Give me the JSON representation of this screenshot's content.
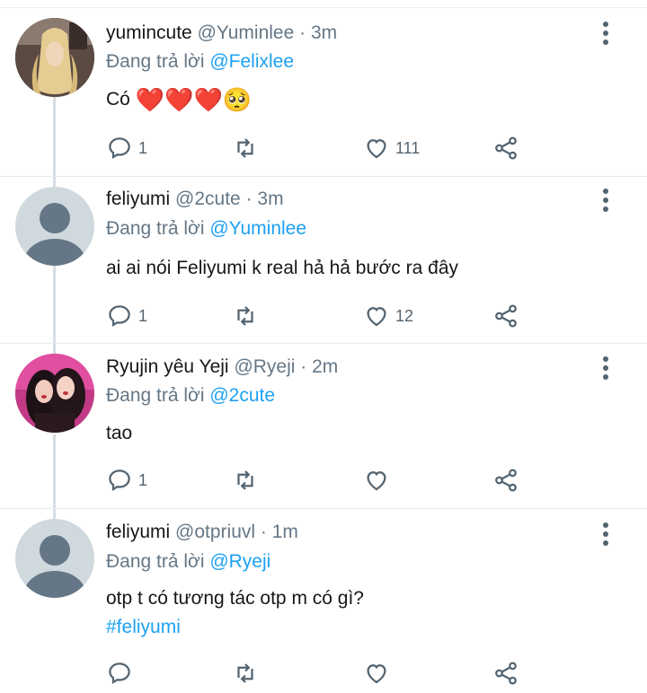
{
  "tweets": [
    {
      "name": "yumincute",
      "handle": "@Yuminlee",
      "dot": "·",
      "time": "3m",
      "reply_prefix": "Đang trả lời",
      "reply_to": "@Felixlee",
      "text": "Có",
      "emojis": [
        "❤️",
        "❤️",
        "❤️",
        "🥺"
      ],
      "replies": "1",
      "retweets": "",
      "likes": "111",
      "avatar": "photo-blonde"
    },
    {
      "name": "feliyumi",
      "handle": "@2cute",
      "dot": "·",
      "time": "3m",
      "reply_prefix": "Đang trả lời",
      "reply_to": "@Yuminlee",
      "text": "ai ai nói Feliyumi k real hả hả bước ra đây",
      "replies": "1",
      "retweets": "",
      "likes": "12",
      "avatar": "default"
    },
    {
      "name": "Ryujin yêu Yeji",
      "handle": "@Ryeji",
      "dot": "·",
      "time": "2m",
      "reply_prefix": "Đang trả lời",
      "reply_to": "@2cute",
      "text": "tao",
      "replies": "1",
      "retweets": "",
      "likes": "",
      "avatar": "photo-pink"
    },
    {
      "name": "feliyumi",
      "handle": "@otpriuvl",
      "dot": "·",
      "time": "1m",
      "reply_prefix": "Đang trả lời",
      "reply_to": "@Ryeji",
      "text": "otp t có tương tác otp m có gì?",
      "hashtag": "#feliyumi",
      "replies": "",
      "retweets": "",
      "likes": "",
      "avatar": "default"
    }
  ],
  "colors": {
    "accent": "#1da1f2",
    "muted": "#657786",
    "icon": "#536471"
  }
}
